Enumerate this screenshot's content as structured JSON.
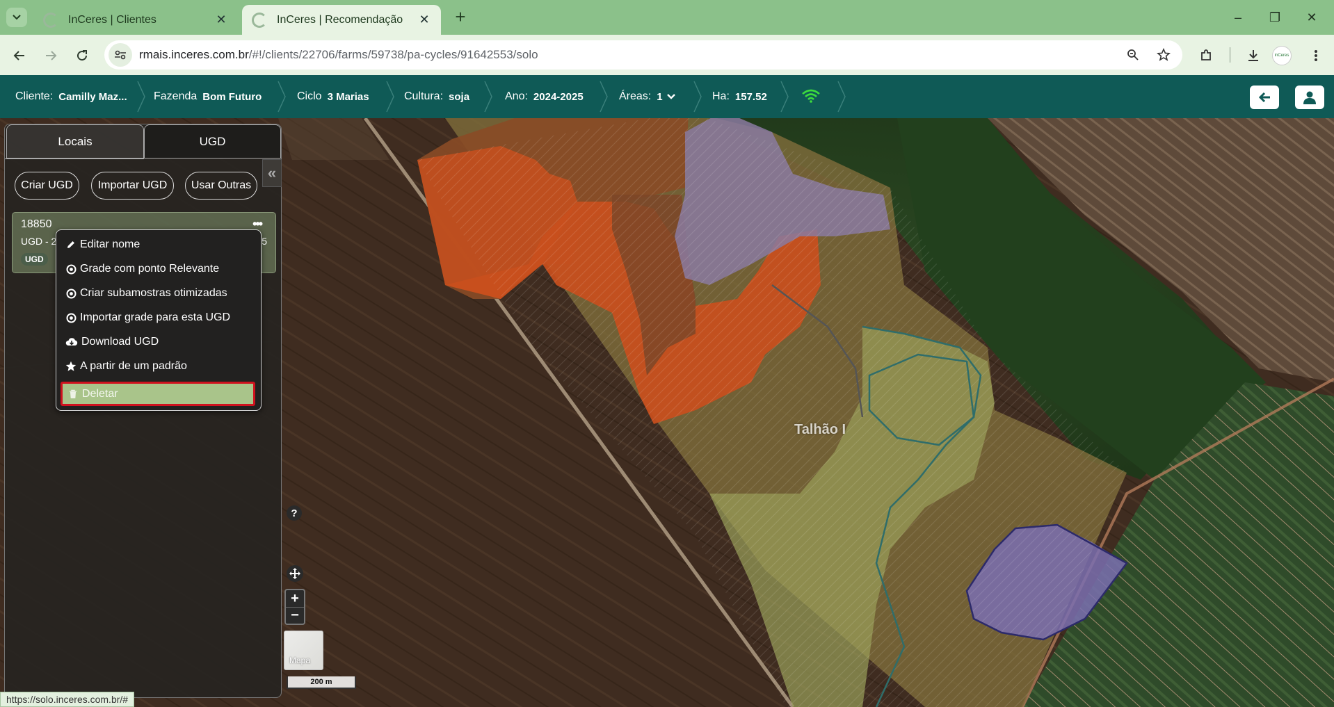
{
  "browser": {
    "tabs": [
      {
        "title": "InCeres | Clientes",
        "active": false
      },
      {
        "title": "InCeres | Recomendação",
        "active": true
      }
    ],
    "url_host": "rmais.inceres.com.br",
    "url_path": "/#!/clients/22706/farms/59738/pa-cycles/91642553/solo",
    "status_url": "https://solo.inceres.com.br/#"
  },
  "header": {
    "cliente_label": "Cliente:",
    "cliente_value": "Camilly Maz...",
    "fazenda_label": "Fazenda",
    "fazenda_value": "Bom Futuro",
    "ciclo_label": "Ciclo",
    "ciclo_value": "3 Marias",
    "cultura_label": "Cultura:",
    "cultura_value": "soja",
    "ano_label": "Ano:",
    "ano_value": "2024-2025",
    "areas_label": "Áreas:",
    "areas_value": "1",
    "ha_label": "Ha:",
    "ha_value": "157.52"
  },
  "panel": {
    "tab_locais": "Locais",
    "tab_ugd": "UGD",
    "btn_criar": "Criar UGD",
    "btn_importar": "Importar UGD",
    "btn_usar": "Usar Outras",
    "card": {
      "id": "18850",
      "subtitle": "UGD - 2",
      "subtitle_end": "5",
      "badge": "UGD"
    }
  },
  "menu": {
    "items": [
      {
        "label": "Editar nome",
        "icon": "pencil-icon"
      },
      {
        "label": "Grade com ponto Relevante",
        "icon": "target-icon"
      },
      {
        "label": "Criar subamostras otimizadas",
        "icon": "target-icon"
      },
      {
        "label": "Importar grade para esta UGD",
        "icon": "target-icon"
      },
      {
        "label": "Download UGD",
        "icon": "cloud-download-icon"
      },
      {
        "label": "A partir de um padrão",
        "icon": "star-icon"
      },
      {
        "label": "Deletar",
        "icon": "trash-icon"
      }
    ]
  },
  "map": {
    "field_label": "Talhão I",
    "minimap_label": "Mapa",
    "scale_label": "200 m",
    "help": "?"
  },
  "colors": {
    "appbar": "#0f5a56",
    "tabstrip": "#8bc18a",
    "delete_highlight": "#a9c48a",
    "delete_border": "#d0121e"
  }
}
